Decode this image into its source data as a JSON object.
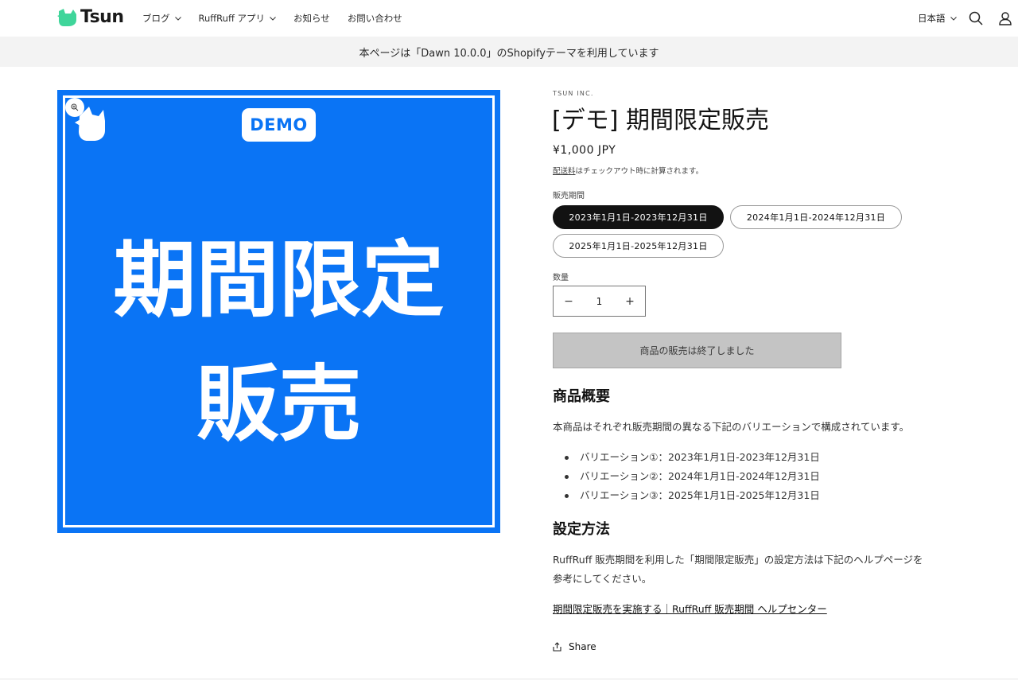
{
  "header": {
    "logo_text": "Tsun",
    "nav": [
      {
        "label": "ブログ",
        "has_dropdown": true
      },
      {
        "label": "RuffRuff アプリ",
        "has_dropdown": true
      },
      {
        "label": "お知らせ",
        "has_dropdown": false
      },
      {
        "label": "お問い合わせ",
        "has_dropdown": false
      }
    ],
    "language": "日本語",
    "icons": [
      "search-icon",
      "account-icon"
    ]
  },
  "announcement": "本ページは「Dawn 10.0.0」のShopifyテーマを利用しています",
  "media": {
    "background_color": "#0a74f5",
    "badge": "DEMO",
    "big_text_line1": "期間限定",
    "big_text_line2": "販売",
    "icons": [
      "zoom-icon",
      "dog-logo-icon"
    ]
  },
  "product": {
    "vendor": "TSUN INC.",
    "title": "[デモ] 期間限定販売",
    "price": "¥1,000 JPY",
    "shipping_link": "配送料",
    "shipping_rest": "はチェックアウト時に計算されます。",
    "option_label": "販売期間",
    "options": [
      {
        "label": "2023年1月1日-2023年12月31日",
        "selected": true
      },
      {
        "label": "2024年1月1日-2024年12月31日",
        "selected": false
      },
      {
        "label": "2025年1月1日-2025年12月31日",
        "selected": false
      }
    ],
    "quantity_label": "数量",
    "quantity": "1",
    "minus": "−",
    "plus": "+",
    "soldout_label": "商品の販売は終了しました"
  },
  "description": {
    "heading1": "商品概要",
    "intro": "本商品はそれぞれ販売期間の異なる下記のバリエーションで構成されています。",
    "bullets": [
      "バリエーション①：2023年1月1日-2023年12月31日",
      "バリエーション②：2024年1月1日-2024年12月31日",
      "バリエーション③：2025年1月1日-2025年12月31日"
    ],
    "heading2": "設定方法",
    "setup_line1": "RuffRuff 販売期間を利用した「期間限定販売」の設定方法は下記のヘルプページを",
    "setup_line2": "参考にしてください。",
    "help_link": "期間限定販売を実施する｜RuffRuff 販売期間 ヘルプセンター",
    "share": "Share"
  },
  "colors": {
    "accent_blue": "#0a74f5",
    "logo_green": "#3fd59a",
    "selected_pill": "#121212",
    "soldout_bg": "#c4c4c4"
  }
}
